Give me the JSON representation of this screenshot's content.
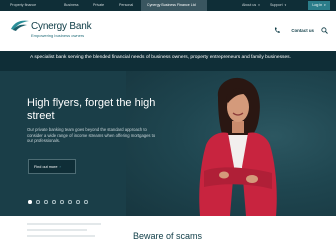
{
  "topnav": {
    "items": [
      {
        "label": "Property finance"
      },
      {
        "label": "Business"
      },
      {
        "label": "Private"
      },
      {
        "label": "Personal"
      },
      {
        "label": "Cynergy Business Finance Ltd"
      }
    ],
    "about_label": "About us",
    "support_label": "Support",
    "login_label": "Log in"
  },
  "brand": {
    "name": "Cynergy Bank",
    "tagline": "Empowering business owners",
    "contact_label": "Contact us"
  },
  "band": {
    "text": "A specialist bank serving the blended financial needs of business owners, property entrepreneurs and family businesses."
  },
  "hero": {
    "title": "High flyers, forget the high street",
    "description": "Our private banking team goes beyond the standard approach to consider a wide range of income streams when offering mortgages to our professionals.",
    "cta_label": "Find out more",
    "slide_count": 8,
    "active_slide": 1
  },
  "notice": {
    "title": "Beware of scams"
  },
  "colors": {
    "dark": "#0f2e37",
    "hero": "#1a3e48",
    "accent": "#2b7d8a",
    "jacket": "#c8243f"
  },
  "icons": {
    "phone": "phone-icon",
    "search": "search-icon",
    "logo": "cynergy-logo-mark"
  }
}
